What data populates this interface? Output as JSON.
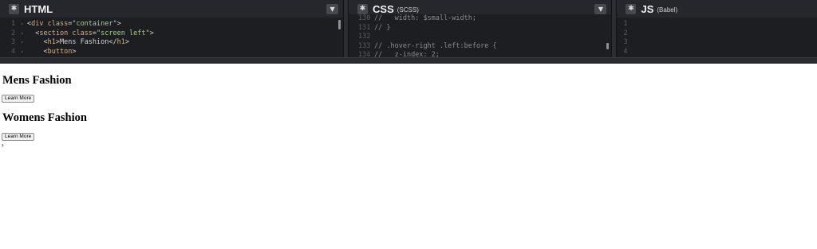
{
  "editors": {
    "html": {
      "title": "HTML",
      "lines": [
        {
          "n": "1",
          "parts": [
            [
              "t-punct",
              "<"
            ],
            [
              "t-tag",
              "div "
            ],
            [
              "t-attr",
              "class"
            ],
            [
              "t-punct",
              "="
            ],
            [
              "t-str",
              "\"container\""
            ],
            [
              "t-punct",
              ">"
            ]
          ],
          "indent": ""
        },
        {
          "n": "2",
          "parts": [
            [
              "t-punct",
              "<"
            ],
            [
              "t-tag",
              "section "
            ],
            [
              "t-attr",
              "class"
            ],
            [
              "t-punct",
              "="
            ],
            [
              "t-str",
              "\"screen left\""
            ],
            [
              "t-punct",
              ">"
            ]
          ],
          "indent": "  "
        },
        {
          "n": "3",
          "parts": [
            [
              "t-punct",
              "<"
            ],
            [
              "t-tag",
              "h1"
            ],
            [
              "t-punct",
              ">"
            ],
            [
              "txt",
              "Mens Fashion"
            ],
            [
              "t-punct",
              "</"
            ],
            [
              "t-tag",
              "h1"
            ],
            [
              "t-punct",
              ">"
            ]
          ],
          "indent": "    "
        },
        {
          "n": "4",
          "parts": [
            [
              "t-punct",
              "<"
            ],
            [
              "t-tag",
              "button"
            ],
            [
              "t-punct",
              ">"
            ]
          ],
          "indent": "    "
        }
      ]
    },
    "css": {
      "title": "CSS",
      "subtitle": "(SCSS)",
      "lines": [
        {
          "n": "130",
          "text": "//   width: $small-width;"
        },
        {
          "n": "131",
          "text": "// }"
        },
        {
          "n": "132",
          "text": ""
        },
        {
          "n": "133",
          "text": "// .hover-right .left:before {"
        },
        {
          "n": "134",
          "text": "//   z-index: 2;"
        }
      ]
    },
    "js": {
      "title": "JS",
      "subtitle": "(Babel)",
      "line_numbers": [
        "1",
        "2",
        "3",
        "4"
      ]
    }
  },
  "preview": {
    "sections": [
      {
        "heading": "Mens Fashion",
        "button": "Learn More"
      },
      {
        "heading": "Womens Fashion",
        "button": "Learn More"
      }
    ],
    "trailing_glyph": "›"
  }
}
